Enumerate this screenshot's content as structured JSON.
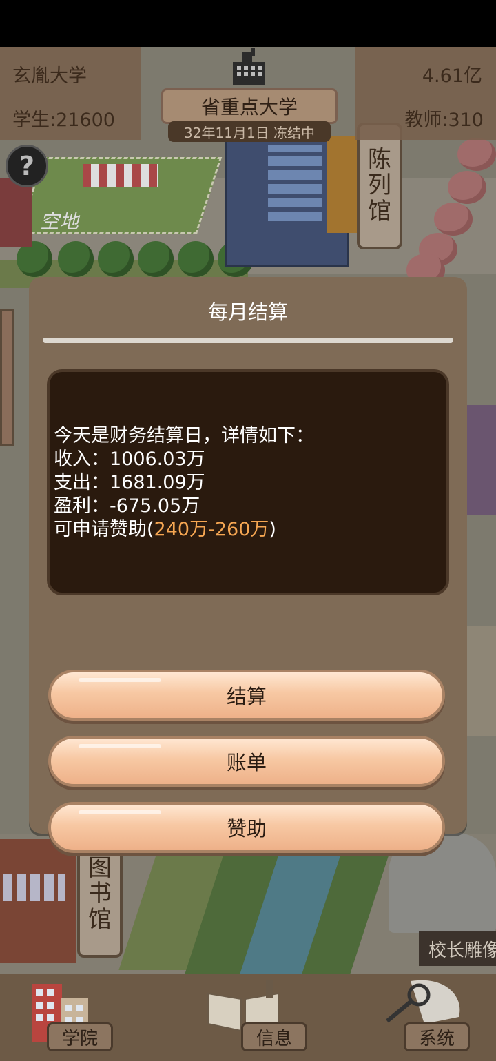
{
  "hud": {
    "university_name": "玄胤大学",
    "money": "4.61亿",
    "students": "学生:21600",
    "teachers": "教师:310",
    "rank": "省重点大学",
    "date_status": "32年11月1日 冻结中",
    "help_label": "?"
  },
  "map": {
    "empty_lot": "空地",
    "exhibition_hall": [
      "陈",
      "列",
      "馆"
    ],
    "library": [
      "图",
      "书",
      "馆"
    ],
    "statue": "校长雕像"
  },
  "dialog": {
    "title": "每月结算",
    "report": {
      "line1": "今天是财务结算日，详情如下：",
      "income": "收入：1006.03万",
      "expense": "支出：1681.09万",
      "profit": "盈利：-675.05万",
      "sponsor_prefix": "可申请赞助(",
      "sponsor_low": "240万",
      "sponsor_dash": "-",
      "sponsor_high": "260万",
      "sponsor_suffix": ")"
    },
    "buttons": {
      "settle": "结算",
      "bill": "账单",
      "sponsor": "赞助"
    }
  },
  "bottom_nav": {
    "college": "学院",
    "info": "信息",
    "system": "系统"
  },
  "colors": {
    "highlight": "#f5a652",
    "dialog_bg": "#7f6b56",
    "report_bg": "#2a1a0e",
    "button": "#f7c8a3"
  }
}
